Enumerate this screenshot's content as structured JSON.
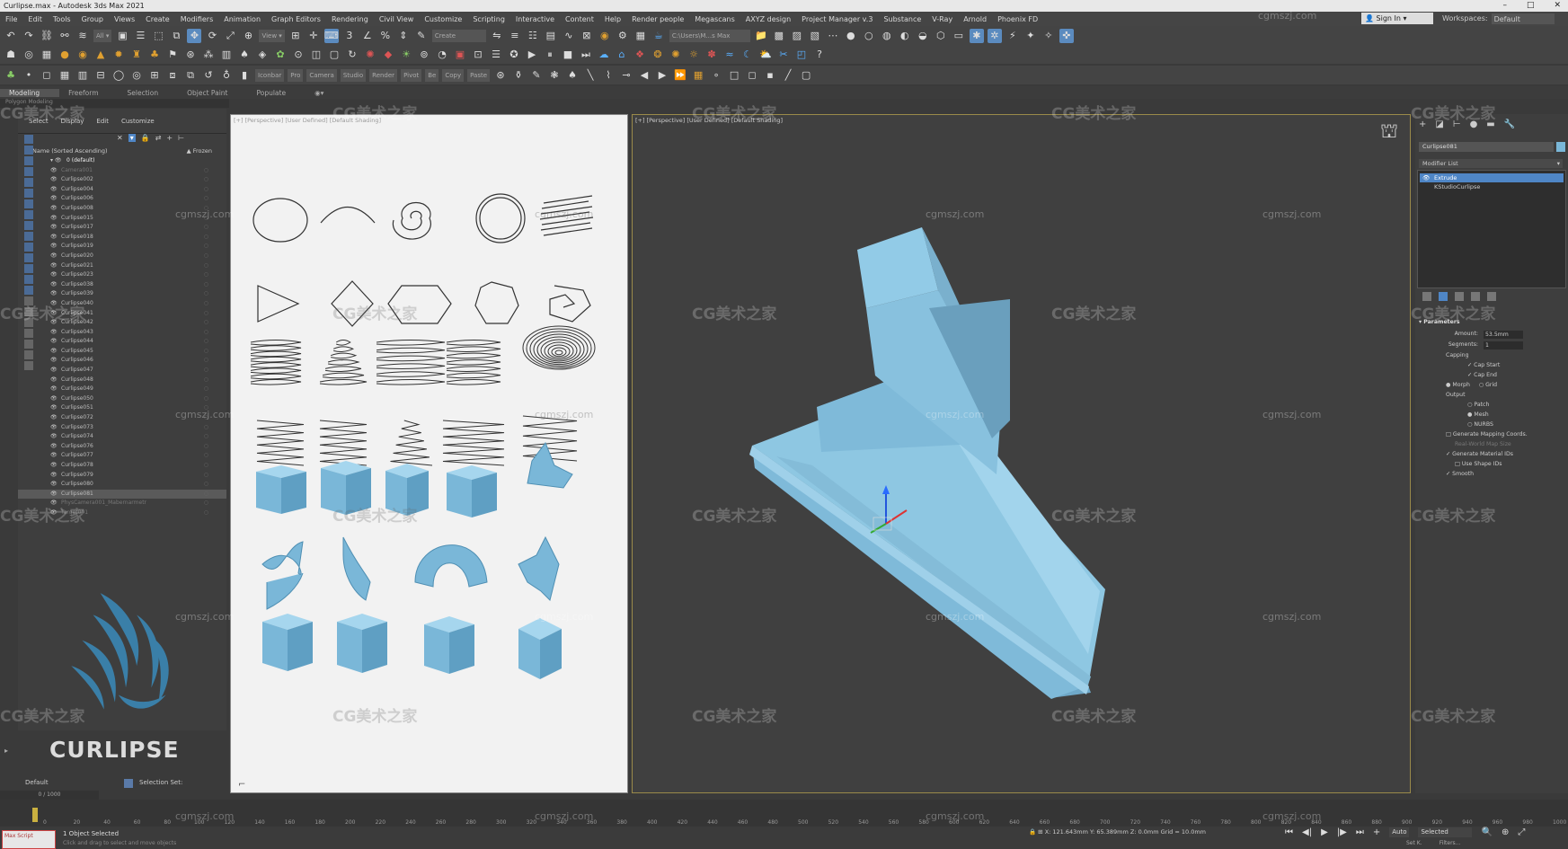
{
  "title": "Curlipse.max - Autodesk 3ds Max 2021",
  "menu": [
    "File",
    "Edit",
    "Tools",
    "Group",
    "Views",
    "Create",
    "Modifiers",
    "Animation",
    "Graph Editors",
    "Rendering",
    "Civil View",
    "Customize",
    "Scripting",
    "Interactive",
    "Content",
    "Help",
    "Render people",
    "Megascans",
    "AXYZ design",
    "Project Manager v.3",
    "Substance",
    "V-Ray",
    "Arnold",
    "Phoenix FD"
  ],
  "signin": "Sign In",
  "workspace_label": "Workspaces:",
  "workspace_value": "Default",
  "toolbar": {
    "selection_filter": "All",
    "view": "View",
    "selection_set": "Create Selection Set",
    "path": "C:\\Users\\M...s Max 2021",
    "copy": "Copy",
    "paste": "Paste",
    "buttons": [
      "Iconbar",
      "Pro",
      "Camera",
      "Studio",
      "Render",
      "Pivot",
      "Be"
    ]
  },
  "ribbon_tabs": [
    "Modeling",
    "Freeform",
    "Selection",
    "Object Paint",
    "Populate"
  ],
  "ribbon_sub": "Polygon Modeling",
  "explorer": {
    "menu": [
      "Select",
      "Display",
      "Edit",
      "Customize"
    ],
    "col_name": "Name (Sorted Ascending)",
    "col_frozen": "▲ Frozen",
    "root": "0 (default)",
    "rows": [
      "Camera001",
      "Curlipse002",
      "Curlipse004",
      "Curlipse006",
      "Curlipse008",
      "Curlipse015",
      "Curlipse017",
      "Curlipse018",
      "Curlipse019",
      "Curlipse020",
      "Curlipse021",
      "Curlipse023",
      "Curlipse038",
      "Curlipse039",
      "Curlipse040",
      "Curlipse041",
      "Curlipse042",
      "Curlipse043",
      "Curlipse044",
      "Curlipse045",
      "Curlipse046",
      "Curlipse047",
      "Curlipse048",
      "Curlipse049",
      "Curlipse050",
      "Curlipse051",
      "Curlipse072",
      "Curlipse073",
      "Curlipse074",
      "Curlipse076",
      "Curlipse077",
      "Curlipse078",
      "Curlipse079",
      "Curlipse080",
      "Curlipse081",
      "PhysCamera001_Mabernarmetr",
      "Target001"
    ]
  },
  "logo_text": "CURLIPSE",
  "layer": {
    "name": "Default",
    "selection_set": "Selection Set:"
  },
  "frame_counter": "0 / 1000",
  "ref_viewport_label": "[+] [Perspective] [User Defined] [Default Shading]",
  "persp_viewport_label": "[+] [Perspective] [User Defined] [Default Shading]",
  "command_panel": {
    "object_name": "Curlipse081",
    "modifier_list": "Modifier List",
    "stack": [
      "Extrude",
      "KStudioCurlipse"
    ],
    "params_title": "Parameters",
    "amount_label": "Amount:",
    "amount": "53.5mm",
    "segments_label": "Segments:",
    "segments": "1",
    "capping": "Capping",
    "cap_start": "Cap Start",
    "cap_end": "Cap End",
    "morph": "Morph",
    "grid": "Grid",
    "output": "Output",
    "patch": "Patch",
    "mesh": "Mesh",
    "nurbs": "NURBS",
    "gen_mapping": "Generate Mapping Coords.",
    "real_world": "Real-World Map Size",
    "gen_material": "Generate Material IDs",
    "use_shape": "Use Shape IDs",
    "smooth": "Smooth"
  },
  "timeline_ticks": [
    "0",
    "20",
    "40",
    "60",
    "80",
    "100",
    "120",
    "140",
    "160",
    "180",
    "200",
    "220",
    "240",
    "260",
    "280",
    "300",
    "320",
    "340",
    "360",
    "380",
    "400",
    "420",
    "440",
    "460",
    "480",
    "500",
    "520",
    "540",
    "560",
    "580",
    "600",
    "620",
    "640",
    "660",
    "680",
    "700",
    "720",
    "740",
    "760",
    "780",
    "800",
    "820",
    "840",
    "860",
    "880",
    "900",
    "920",
    "940",
    "960",
    "980",
    "1000"
  ],
  "status": {
    "selected": "1 Object Selected",
    "hint": "Click and drag to select and move objects",
    "maxscript": "Max Script",
    "coords": "X: 121.643mm  Y: 65.389mm  Z: 0.0mm   Grid = 10.0mm",
    "auto": "Auto",
    "selected_dd": "Selected",
    "set_key": "Set K.",
    "filters": "Filters..."
  },
  "watermarks": {
    "brand": "CG美术之家",
    "site": "cgmszj.com"
  },
  "colors": {
    "object": "#7ab7d8",
    "accent": "#4f86c6"
  }
}
